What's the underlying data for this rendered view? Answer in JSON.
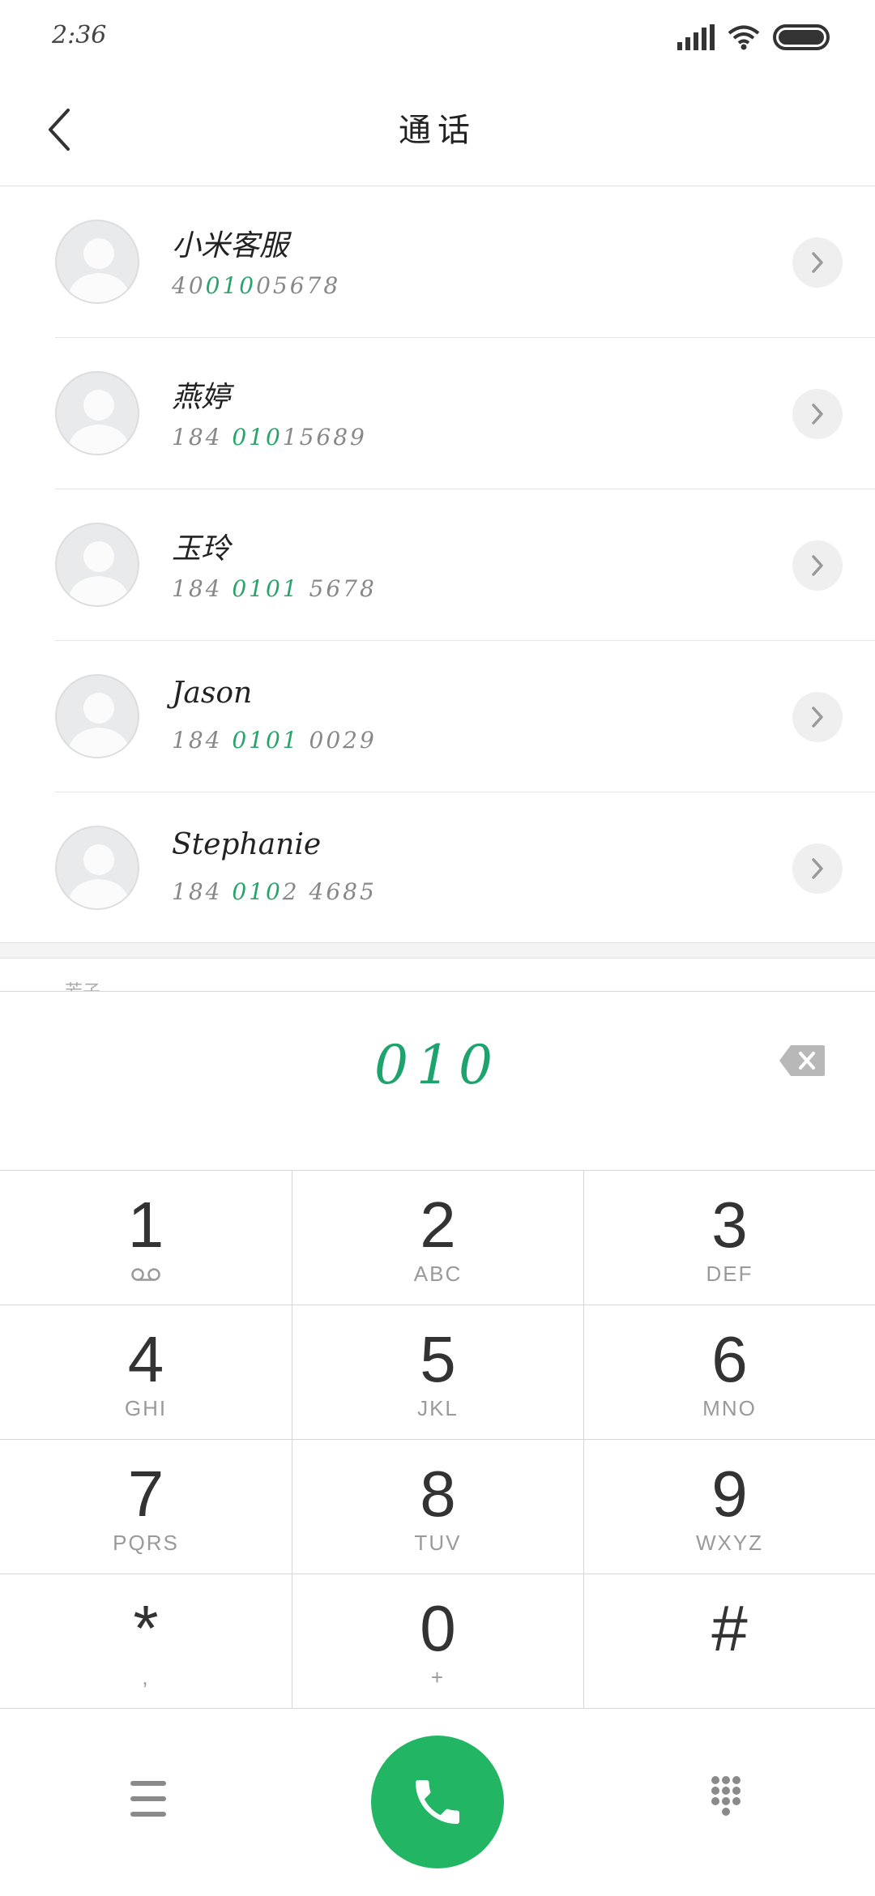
{
  "status_bar": {
    "time": "2:36"
  },
  "title_bar": {
    "title": "通话"
  },
  "contacts": [
    {
      "name": "小米客服",
      "number_pre": "40",
      "number_hl": "010",
      "number_post": "05678"
    },
    {
      "name": "燕婷",
      "number_pre": "184 ",
      "number_hl": "010",
      "number_post": "15689"
    },
    {
      "name": "玉玲",
      "number_pre": "184 ",
      "number_hl": "0101",
      "number_post": " 5678"
    },
    {
      "name": "Jason",
      "number_pre": "184 ",
      "number_hl": "0101",
      "number_post": " 0029"
    },
    {
      "name": "Stephanie",
      "number_pre": "184 ",
      "number_hl": "010",
      "number_post": "2 4685"
    }
  ],
  "peek_text": "芳子",
  "dial": {
    "number": "010"
  },
  "keypad": [
    {
      "digit": "1",
      "letters": ""
    },
    {
      "digit": "2",
      "letters": "ABC"
    },
    {
      "digit": "3",
      "letters": "DEF"
    },
    {
      "digit": "4",
      "letters": "GHI"
    },
    {
      "digit": "5",
      "letters": "JKL"
    },
    {
      "digit": "6",
      "letters": "MNO"
    },
    {
      "digit": "7",
      "letters": "PQRS"
    },
    {
      "digit": "8",
      "letters": "TUV"
    },
    {
      "digit": "9",
      "letters": "WXYZ"
    },
    {
      "digit": "*",
      "letters": ","
    },
    {
      "digit": "0",
      "letters": "+"
    },
    {
      "digit": "#",
      "letters": ""
    }
  ],
  "icons": {
    "back": "back-arrow-icon",
    "detail": "chevron-right-icon",
    "delete": "backspace-icon",
    "voicemail": "voicemail-icon",
    "menu": "menu-icon",
    "call": "phone-icon",
    "keypad": "dialpad-icon"
  },
  "colors": {
    "accent": "#1fa36e",
    "call_button": "#22b563"
  }
}
